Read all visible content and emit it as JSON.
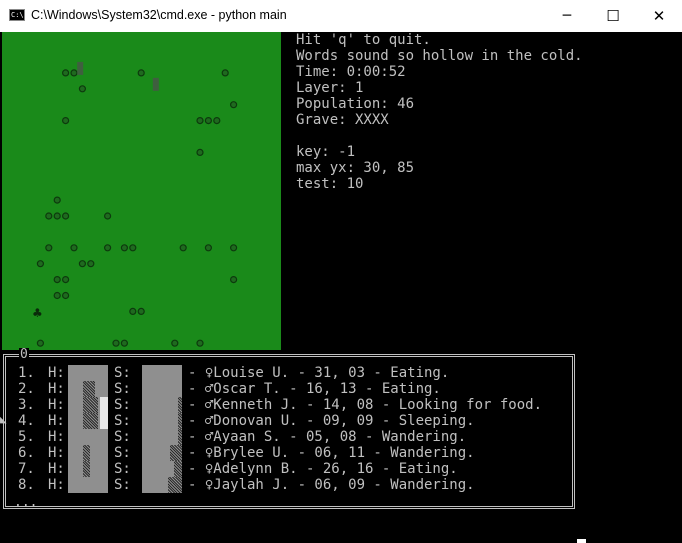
{
  "window": {
    "title": "C:\\Windows\\System32\\cmd.exe - python  main",
    "icon_text": "C:\\",
    "minimize_glyph": "─",
    "maximize_glyph": "☐",
    "close_glyph": "✕"
  },
  "colors": {
    "map_green": "#1a8a1a",
    "console_text": "#c0c0c0",
    "console_bg": "#000000"
  },
  "info": {
    "lines": [
      "Hit 'q' to quit.",
      "Words sound so hollow in the cold.",
      "Time: 0:00:52",
      "Layer: 1",
      "Population: 46",
      "Grave: XXXX",
      "",
      "key: -1",
      "max yx: 30, 85",
      "test: 10"
    ]
  },
  "status_box": {
    "title": "0",
    "h_label": "H:",
    "s_label": "S:",
    "scroll_marker": "◣",
    "footer": "...",
    "rows": [
      {
        "num": "1.",
        "health": 0.0,
        "stamina": 0.0,
        "text": "- ♀Louise U. - 31, 03 - Eating."
      },
      {
        "num": "2.",
        "health": 0.6,
        "stamina": 0.0,
        "text": "- ♂Oscar T. - 16, 13 - Eating."
      },
      {
        "num": "3.",
        "health": 0.75,
        "stamina": 0.1,
        "text": "- ♂Kenneth J. - 14, 08 - Looking for food."
      },
      {
        "num": "4.",
        "health": 0.75,
        "stamina": 0.1,
        "text": "- ♂Donovan U. - 09, 09 - Sleeping."
      },
      {
        "num": "5.",
        "health": 0.0,
        "stamina": 0.1,
        "text": "- ♂Ayaan S. - 05, 08 - Wandering."
      },
      {
        "num": "6.",
        "health": 0.35,
        "stamina": 0.3,
        "text": "- ♀Brylee U. - 06, 11 - Wandering."
      },
      {
        "num": "7.",
        "health": 0.35,
        "stamina": 0.2,
        "text": "- ♀Adelynn B. - 26, 16 - Eating."
      },
      {
        "num": "8.",
        "health": 0.0,
        "stamina": 0.35,
        "text": "- ♀Jaylah J. - 06, 09 - Wandering."
      }
    ]
  },
  "map": {
    "people_cells": [
      [
        4,
        1
      ],
      [
        5,
        1
      ],
      [
        23,
        1
      ],
      [
        24,
        3
      ],
      [
        20,
        4
      ],
      [
        21,
        4
      ],
      [
        22,
        4
      ],
      [
        4,
        4
      ],
      [
        20,
        6
      ],
      [
        3,
        9
      ],
      [
        2,
        10
      ],
      [
        3,
        10
      ],
      [
        4,
        10
      ],
      [
        9,
        10
      ],
      [
        2,
        12
      ],
      [
        5,
        12
      ],
      [
        9,
        12
      ],
      [
        7,
        13
      ],
      [
        3,
        15
      ],
      [
        4,
        15
      ],
      [
        3,
        14
      ],
      [
        11,
        12
      ],
      [
        18,
        12
      ],
      [
        21,
        12
      ],
      [
        24,
        12
      ],
      [
        1,
        13
      ],
      [
        24,
        14
      ],
      [
        4,
        14
      ],
      [
        6,
        13
      ],
      [
        12,
        12
      ],
      [
        1,
        18
      ],
      [
        10,
        18
      ],
      [
        11,
        18
      ],
      [
        17,
        18
      ],
      [
        20,
        18
      ],
      [
        12,
        16
      ],
      [
        13,
        16
      ],
      [
        17,
        21
      ],
      [
        17,
        23
      ],
      [
        18,
        23
      ],
      [
        19,
        23
      ],
      [
        6,
        2
      ],
      [
        13,
        1
      ]
    ]
  }
}
